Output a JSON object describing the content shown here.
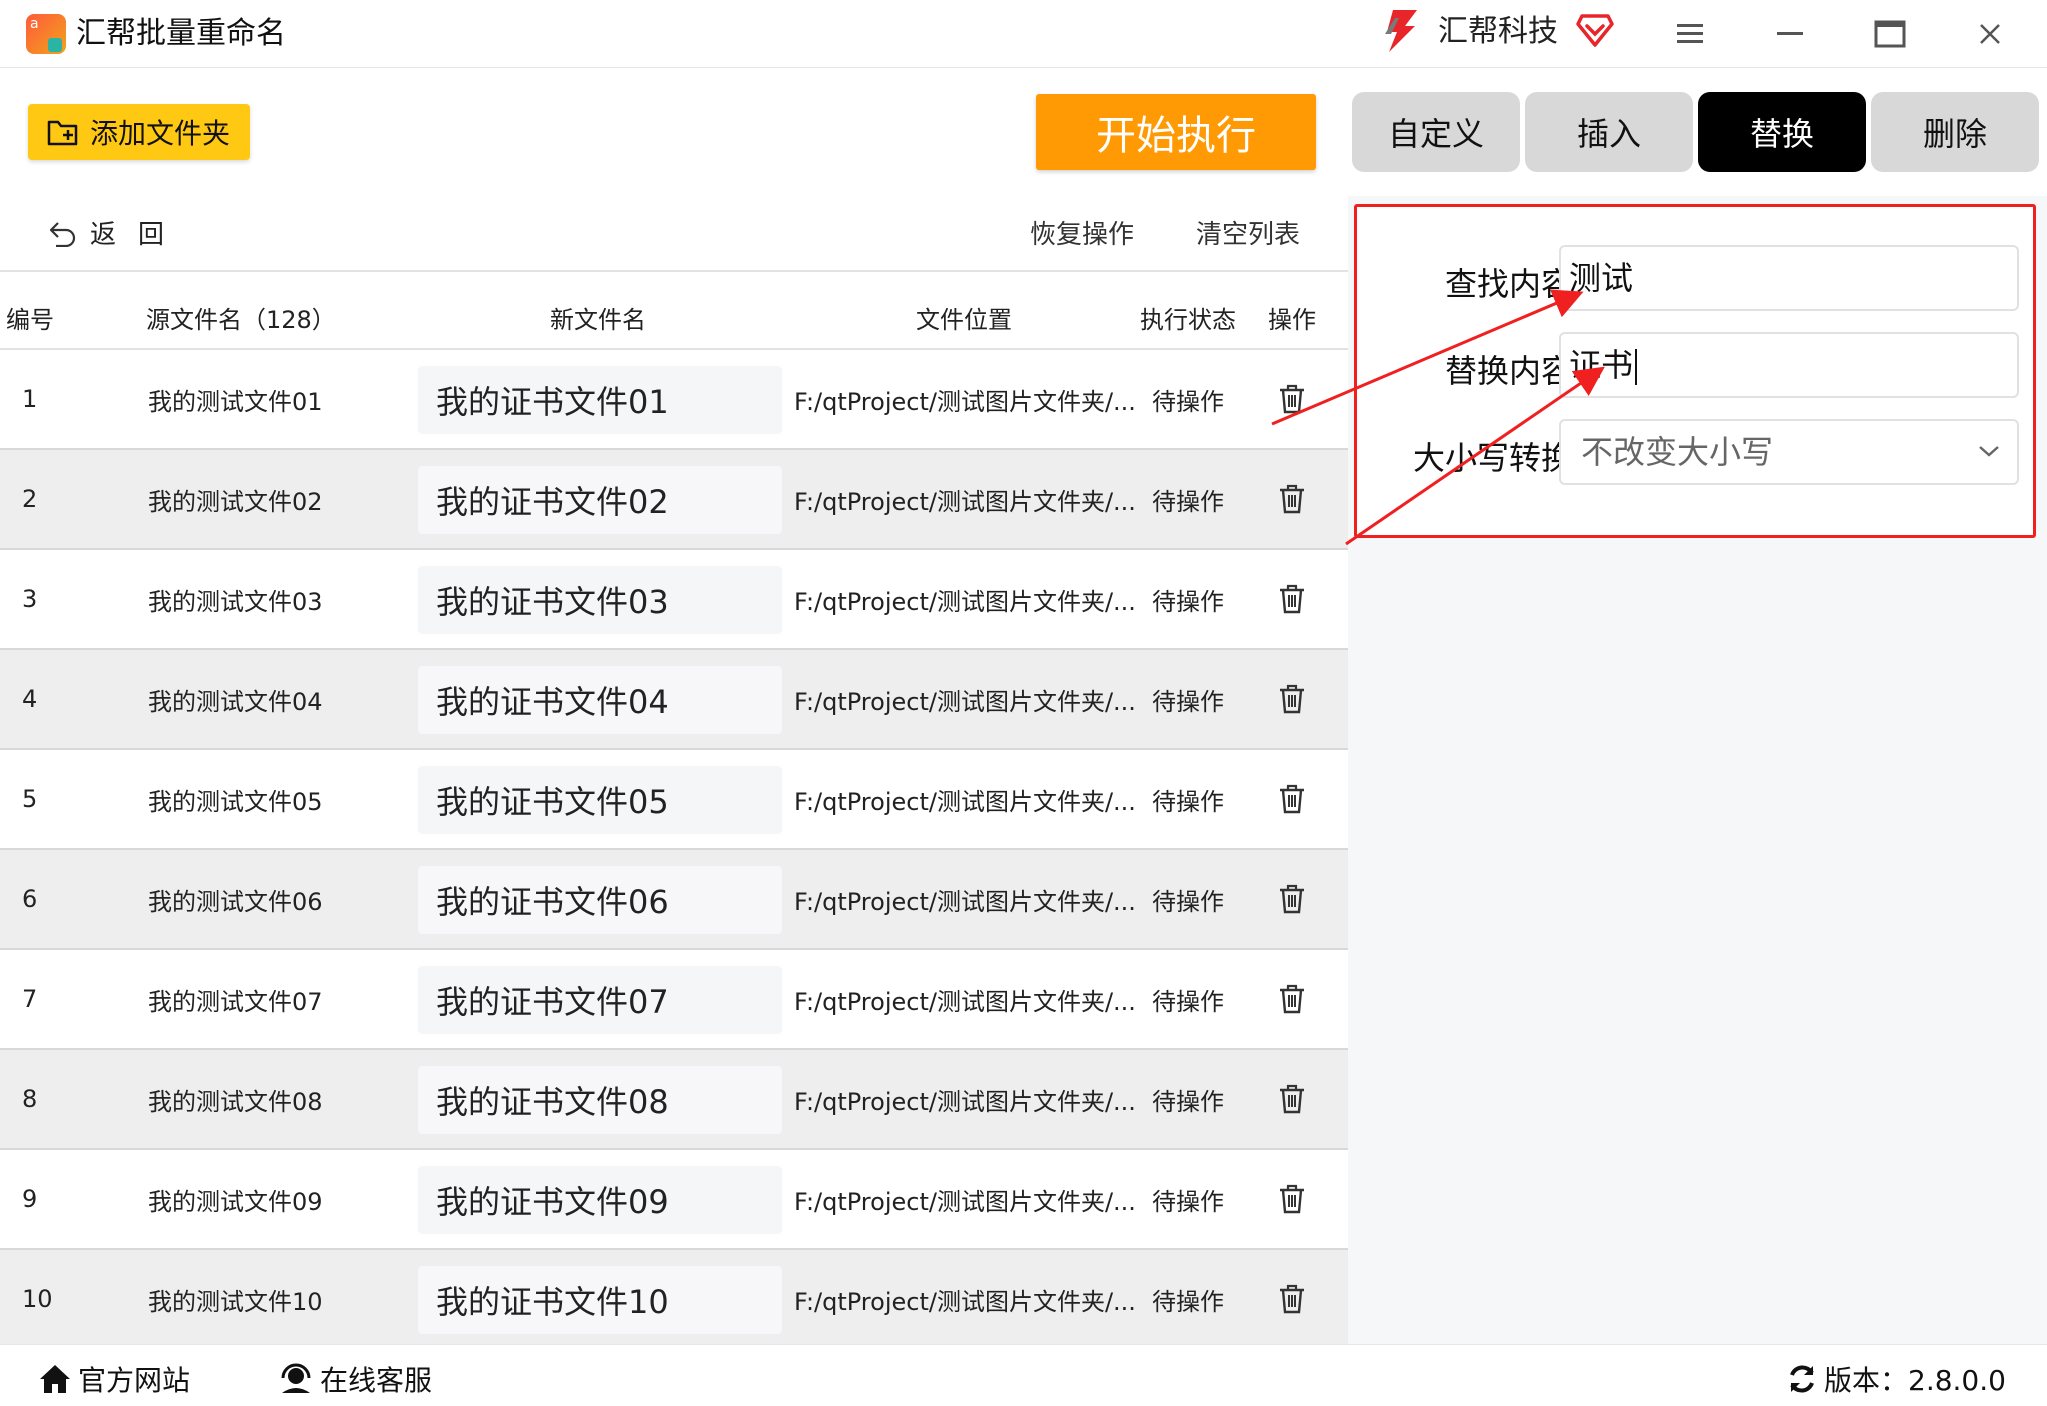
{
  "app": {
    "title": "汇帮批量重命名",
    "logo_text": "a",
    "brand": "汇帮科技"
  },
  "toolbar": {
    "add_folder": "添加文件夹",
    "start": "开始执行"
  },
  "tabs": [
    {
      "label": "自定义",
      "active": false
    },
    {
      "label": "插入",
      "active": false
    },
    {
      "label": "替换",
      "active": true
    },
    {
      "label": "删除",
      "active": false
    }
  ],
  "actions": {
    "back": "返回",
    "restore": "恢复操作",
    "clear": "清空列表"
  },
  "table": {
    "headers": {
      "index": "编号",
      "source": "源文件名（128）",
      "new_name": "新文件名",
      "location": "文件位置",
      "status": "执行状态",
      "op": "操作"
    },
    "rows": [
      {
        "index": "1",
        "source": "我的测试文件01",
        "new_name": "我的证书文件01",
        "location": "F:/qtProject/测试图片文件夹/...",
        "status": "待操作"
      },
      {
        "index": "2",
        "source": "我的测试文件02",
        "new_name": "我的证书文件02",
        "location": "F:/qtProject/测试图片文件夹/...",
        "status": "待操作"
      },
      {
        "index": "3",
        "source": "我的测试文件03",
        "new_name": "我的证书文件03",
        "location": "F:/qtProject/测试图片文件夹/...",
        "status": "待操作"
      },
      {
        "index": "4",
        "source": "我的测试文件04",
        "new_name": "我的证书文件04",
        "location": "F:/qtProject/测试图片文件夹/...",
        "status": "待操作"
      },
      {
        "index": "5",
        "source": "我的测试文件05",
        "new_name": "我的证书文件05",
        "location": "F:/qtProject/测试图片文件夹/...",
        "status": "待操作"
      },
      {
        "index": "6",
        "source": "我的测试文件06",
        "new_name": "我的证书文件06",
        "location": "F:/qtProject/测试图片文件夹/...",
        "status": "待操作"
      },
      {
        "index": "7",
        "source": "我的测试文件07",
        "new_name": "我的证书文件07",
        "location": "F:/qtProject/测试图片文件夹/...",
        "status": "待操作"
      },
      {
        "index": "8",
        "source": "我的测试文件08",
        "new_name": "我的证书文件08",
        "location": "F:/qtProject/测试图片文件夹/...",
        "status": "待操作"
      },
      {
        "index": "9",
        "source": "我的测试文件09",
        "new_name": "我的证书文件09",
        "location": "F:/qtProject/测试图片文件夹/...",
        "status": "待操作"
      },
      {
        "index": "10",
        "source": "我的测试文件10",
        "new_name": "我的证书文件10",
        "location": "F:/qtProject/测试图片文件夹/...",
        "status": "待操作"
      }
    ]
  },
  "replace_form": {
    "find_label": "查找内容",
    "find_value": "测试",
    "replace_label": "替换内容",
    "replace_value": "证书",
    "case_label": "大小写转换",
    "case_value": "不改变大小写"
  },
  "footer": {
    "website": "官方网站",
    "support": "在线客服",
    "version": "版本：2.8.0.0"
  },
  "icons": {
    "back": "undo-arrow-icon",
    "delete": "trash-icon",
    "menu": "hamburger-menu-icon",
    "minimize": "minimize-icon",
    "maximize": "maximize-icon",
    "close": "close-icon",
    "vip": "diamond-heart-icon",
    "website": "home-icon",
    "support": "headset-icon",
    "version": "refresh-icon",
    "add_folder": "folder-add-icon"
  },
  "colors": {
    "accent_orange": "#ff9a05",
    "add_folder_yellow": "#ffc812",
    "annotation_red": "#f02020",
    "tab_active": "#000000",
    "tab_inactive": "#d8d8d8"
  }
}
